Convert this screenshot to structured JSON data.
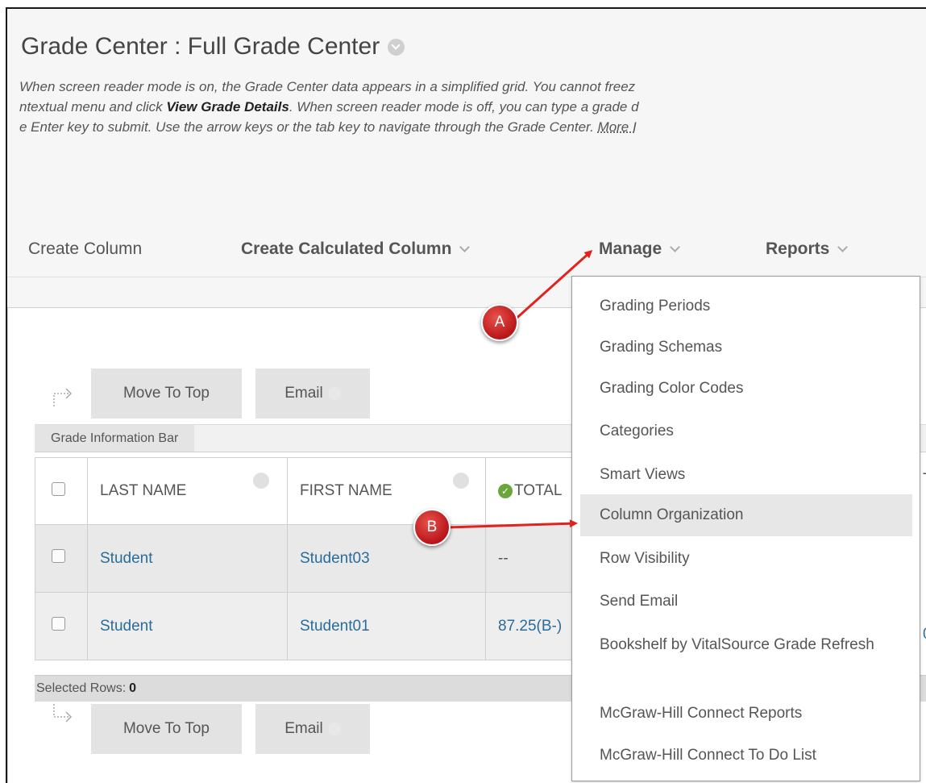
{
  "page": {
    "title": "Grade Center : Full Grade Center",
    "instructions": {
      "line1_text": "When screen reader mode is on, the Grade Center data appears in a simplified grid. You cannot freez",
      "line2_pre": "ntextual menu and click ",
      "line2_bold": "View Grade Details",
      "line2_post": ". When screen reader mode is off, you can type a grade d",
      "line3_text": "e Enter key to submit. Use the arrow keys or the tab key to navigate through the Grade Center. ",
      "line3_link": "More I"
    }
  },
  "action_bar": {
    "create_column": "Create Column",
    "create_calculated_column": "Create Calculated Column",
    "manage": "Manage",
    "reports": "Reports"
  },
  "toolbar": {
    "move_to_top": "Move To Top",
    "email": "Email"
  },
  "info_bar": {
    "label": "Grade Information Bar"
  },
  "grid": {
    "columns": [
      "LAST NAME",
      "FIRST NAME",
      "TOTAL"
    ],
    "rows": [
      {
        "last_name": "Student",
        "first_name": "Student03",
        "total": "--"
      },
      {
        "last_name": "Student",
        "first_name": "Student01",
        "total": "87.25(B-)"
      }
    ],
    "edge_fragments": [
      "T",
      "0"
    ]
  },
  "selected_rows": {
    "label": "Selected Rows:",
    "count": "0"
  },
  "manage_menu": {
    "items": [
      "Grading Periods",
      "Grading Schemas",
      "Grading Color Codes",
      "Categories",
      "Smart Views",
      "Column Organization",
      "Row Visibility",
      "Send Email",
      "Bookshelf by VitalSource Grade Refresh",
      "McGraw-Hill Connect Reports",
      "McGraw-Hill Connect To Do List"
    ],
    "highlighted_index": 5
  },
  "annotations": {
    "a": "A",
    "b": "B",
    "arrow_color": "#e0231e"
  },
  "colors": {
    "link": "#2a6c9b",
    "badge": "#c41b20",
    "highlight": "#e7e7e7"
  }
}
